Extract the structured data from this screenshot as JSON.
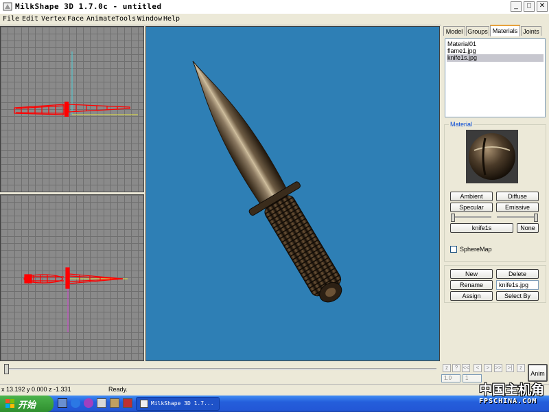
{
  "window": {
    "title": "MilkShape 3D 1.7.0c - untitled",
    "minimize_label": "_",
    "maximize_label": "□",
    "close_label": "✕"
  },
  "menu": [
    "File",
    "Edit",
    "Vertex",
    "Face",
    "Animate",
    "Tools",
    "Window",
    "Help"
  ],
  "panel": {
    "tabs": [
      "Model",
      "Groups",
      "Materials",
      "Joints"
    ],
    "active_tab": "Materials",
    "materials": [
      "Material01",
      "flame1.jpg",
      "knife1s.jpg"
    ],
    "selected_material": "knife1s.jpg",
    "material_group_label": "Material",
    "ambient_label": "Ambient",
    "diffuse_label": "Diffuse",
    "specular_label": "Specular",
    "emissive_label": "Emissive",
    "texture_button_label": "knife1s",
    "none_label": "None",
    "spheremap_label": "SphereMap",
    "new_label": "New",
    "delete_label": "Delete",
    "rename_label": "Rename",
    "rename_value": "knife1s.jpg",
    "assign_label": "Assign",
    "selectby_label": "Select By"
  },
  "animation": {
    "buttons": [
      "?",
      "<<",
      "<",
      ">",
      ">>",
      ">|"
    ],
    "frame_start": "1.0",
    "frame_end": "1",
    "anim_label": "Anim"
  },
  "status": {
    "coords": "x 13.192 y 0.000 z -1.331",
    "message": "Ready."
  },
  "taskbar": {
    "start_label": "开始",
    "task_label": "MilkShape 3D 1.7...",
    "watermark_main": "中国主机角",
    "watermark_sub": "FPSCHINA.COM"
  },
  "colors": {
    "viewport_3d_bg": "#2e7fb5",
    "wireframe": "#ff0000",
    "taskbar": "#245edb"
  }
}
